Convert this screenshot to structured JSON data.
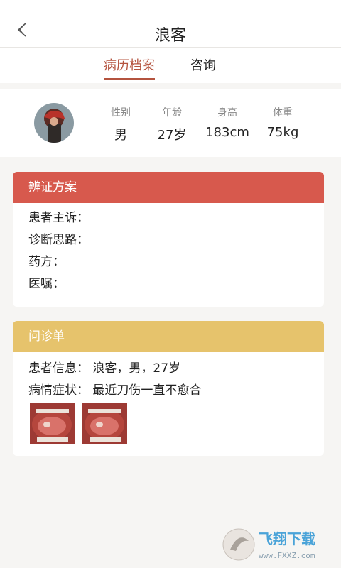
{
  "header": {
    "title": "浪客"
  },
  "tabs": [
    {
      "label": "病历档案",
      "active": true
    },
    {
      "label": "咨询",
      "active": false
    }
  ],
  "profile": {
    "stats": [
      {
        "label": "性别",
        "value": "男"
      },
      {
        "label": "年龄",
        "value": "27岁"
      },
      {
        "label": "身高",
        "value": "183cm"
      },
      {
        "label": "体重",
        "value": "75kg"
      }
    ]
  },
  "diagnosis_card": {
    "title": "辨证方案",
    "rows": [
      "患者主诉：",
      "诊断思路：",
      "药方：",
      "医嘱："
    ]
  },
  "consult_card": {
    "title": "问诊单",
    "patient_info": "患者信息： 浪客，男，27岁",
    "symptoms": "病情症状： 最近刀伤一直不愈合"
  },
  "watermark": {
    "brand": "飞翔下载",
    "url": "www.FXXZ.com"
  },
  "colors": {
    "accent": "#b4533e",
    "red_header": "#d7594d",
    "gold_header": "#e6c36c"
  },
  "icons": {
    "back": "chevron-left-icon"
  }
}
